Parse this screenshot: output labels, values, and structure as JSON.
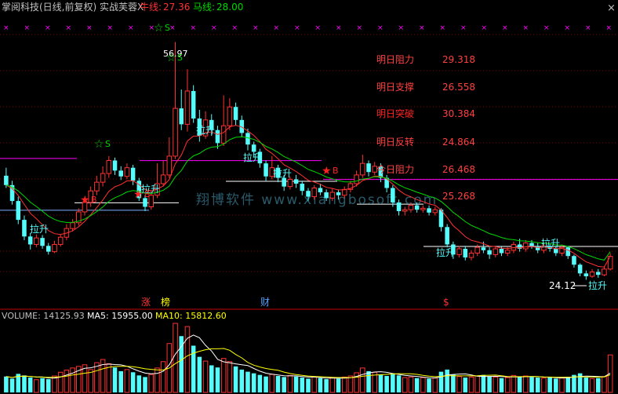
{
  "header": {
    "title": "掌阅科技(日线,前复权) 实战芙蓉X",
    "niu_label": "牛线:",
    "niu_value": "27.36",
    "ma_label": "马线:",
    "ma_value": "28.00",
    "close_icon": "×"
  },
  "colors": {
    "up": "#ff3232",
    "down": "#54fcfc",
    "niu": "#ff3232",
    "ma": "#00d800",
    "magenta": "#ff00ff",
    "level": "#ffffff",
    "grid": "#800000",
    "vol_ma5": "#ffffff",
    "vol_ma10": "#ffff00"
  },
  "panel_labels": {
    "tomorrow_resistance_label": "明日阻力",
    "tomorrow_resistance_value": "29.318",
    "tomorrow_support_label": "明日支撑",
    "tomorrow_support_value": "26.558",
    "tomorrow_breakout_label": "明日突破",
    "tomorrow_breakout_value": "30.384",
    "tomorrow_reversal_label": "明日反转",
    "tomorrow_reversal_value": "24.864",
    "today_resistance_label": "今日阻力",
    "today_resistance_value": "26.468",
    "today_support_value": "25.268"
  },
  "annotations": {
    "high_price": "56.97",
    "low_price": "24.12",
    "pull_up": "拉升",
    "buy": "B",
    "sell": "S",
    "watermark": "翔博软件 www.xiangbosoft.com",
    "event_zhang": "涨",
    "event_bang": "榜",
    "event_cai": "财",
    "event_dollar": "$"
  },
  "volume": {
    "volume_label": "VOLUME: 14125.93",
    "ma5_label": "MA5: 15955.00",
    "ma10_label": "MA10: 15812.60"
  },
  "chart_data": {
    "type": "candlestick",
    "title": "掌阅科技(日线,前复权) 实战芙蓉X",
    "ylim": [
      22,
      58
    ],
    "candles": [
      [
        38.5,
        37.2,
        39.6,
        36.8
      ],
      [
        37.2,
        35.0,
        37.8,
        34.5
      ],
      [
        35.0,
        32.4,
        35.6,
        31.8
      ],
      [
        32.4,
        30.1,
        33.0,
        29.6
      ],
      [
        30.1,
        29.0,
        30.6,
        28.3
      ],
      [
        29.0,
        29.9,
        30.4,
        28.6
      ],
      [
        29.9,
        28.8,
        30.3,
        28.4
      ],
      [
        28.8,
        28.0,
        29.2,
        27.6
      ],
      [
        28.0,
        29.0,
        29.5,
        27.8
      ],
      [
        29.0,
        30.0,
        30.4,
        28.7
      ],
      [
        30.0,
        31.2,
        31.8,
        29.6
      ],
      [
        31.2,
        32.0,
        32.5,
        30.8
      ],
      [
        32.0,
        33.5,
        34.0,
        31.6
      ],
      [
        33.5,
        34.8,
        35.4,
        33.0
      ],
      [
        34.8,
        36.4,
        37.0,
        34.2
      ],
      [
        36.4,
        37.6,
        38.5,
        35.8
      ],
      [
        37.6,
        38.8,
        39.8,
        37.0
      ],
      [
        38.8,
        40.6,
        41.2,
        38.2
      ],
      [
        40.6,
        39.2,
        41.0,
        38.6
      ],
      [
        39.2,
        38.4,
        39.8,
        37.9
      ],
      [
        38.4,
        39.6,
        40.2,
        38.0
      ],
      [
        39.6,
        37.8,
        40.0,
        37.2
      ],
      [
        37.8,
        35.4,
        38.2,
        35.0
      ],
      [
        35.4,
        34.2,
        35.8,
        33.6
      ],
      [
        34.2,
        35.8,
        36.4,
        33.8
      ],
      [
        35.8,
        37.4,
        40.2,
        35.4
      ],
      [
        37.4,
        38.6,
        40.6,
        37.0
      ],
      [
        38.6,
        41.2,
        43.8,
        38.2
      ],
      [
        41.2,
        47.8,
        56.97,
        40.8
      ],
      [
        47.8,
        45.6,
        50.4,
        44.8
      ],
      [
        45.6,
        50.2,
        53.2,
        44.6
      ],
      [
        50.2,
        46.4,
        51.0,
        45.8
      ],
      [
        46.4,
        44.0,
        47.6,
        43.2
      ],
      [
        44.0,
        46.2,
        47.4,
        43.6
      ],
      [
        46.2,
        44.8,
        47.0,
        44.0
      ],
      [
        44.8,
        43.0,
        45.4,
        42.2
      ],
      [
        43.0,
        45.4,
        49.6,
        42.6
      ],
      [
        45.4,
        48.0,
        49.2,
        44.8
      ],
      [
        48.0,
        46.2,
        48.6,
        45.4
      ],
      [
        46.2,
        44.4,
        46.8,
        43.8
      ],
      [
        44.4,
        42.8,
        45.0,
        42.0
      ],
      [
        42.8,
        41.8,
        43.2,
        41.0
      ],
      [
        41.8,
        40.2,
        42.2,
        39.6
      ],
      [
        40.2,
        38.4,
        40.6,
        37.8
      ],
      [
        38.4,
        39.6,
        41.2,
        38.0
      ],
      [
        39.6,
        38.2,
        40.0,
        37.6
      ],
      [
        38.2,
        37.0,
        38.6,
        36.4
      ],
      [
        37.0,
        38.0,
        38.4,
        36.6
      ],
      [
        38.0,
        37.4,
        38.6,
        36.8
      ],
      [
        37.4,
        36.4,
        37.8,
        35.8
      ],
      [
        36.4,
        35.6,
        36.8,
        35.0
      ],
      [
        35.6,
        36.8,
        37.2,
        35.2
      ],
      [
        36.8,
        36.2,
        37.4,
        35.8
      ],
      [
        36.2,
        35.4,
        36.6,
        35.0
      ],
      [
        35.4,
        36.2,
        36.8,
        35.0
      ],
      [
        36.2,
        35.8,
        36.6,
        35.2
      ],
      [
        35.8,
        36.6,
        37.0,
        35.4
      ],
      [
        36.6,
        37.4,
        37.8,
        36.2
      ],
      [
        37.4,
        38.6,
        39.2,
        37.0
      ],
      [
        38.6,
        40.2,
        41.4,
        38.2
      ],
      [
        40.2,
        39.0,
        40.6,
        38.4
      ],
      [
        39.0,
        39.8,
        40.4,
        38.6
      ],
      [
        39.8,
        38.2,
        40.2,
        37.6
      ],
      [
        38.2,
        36.8,
        38.6,
        36.2
      ],
      [
        36.8,
        34.8,
        37.2,
        34.2
      ],
      [
        34.8,
        33.6,
        35.2,
        33.0
      ],
      [
        33.6,
        33.8,
        34.2,
        33.0
      ],
      [
        33.8,
        34.4,
        34.8,
        33.4
      ],
      [
        34.4,
        33.8,
        34.8,
        33.4
      ],
      [
        33.8,
        34.0,
        34.4,
        33.4
      ],
      [
        34.0,
        33.4,
        34.4,
        33.0
      ],
      [
        33.4,
        33.8,
        34.2,
        33.0
      ],
      [
        33.8,
        31.4,
        34.0,
        30.8
      ],
      [
        31.4,
        29.0,
        31.8,
        28.6
      ],
      [
        29.0,
        27.6,
        29.4,
        27.0
      ],
      [
        27.6,
        28.4,
        28.8,
        27.2
      ],
      [
        28.4,
        27.2,
        28.8,
        26.8
      ],
      [
        27.2,
        27.8,
        28.2,
        26.8
      ],
      [
        27.8,
        28.6,
        29.0,
        27.4
      ],
      [
        28.6,
        28.2,
        29.4,
        27.8
      ],
      [
        28.2,
        27.6,
        28.6,
        27.0
      ],
      [
        27.6,
        28.4,
        28.8,
        27.2
      ],
      [
        28.4,
        27.8,
        28.8,
        27.4
      ],
      [
        27.8,
        28.2,
        28.6,
        27.4
      ],
      [
        28.2,
        29.0,
        29.4,
        27.8
      ],
      [
        29.0,
        28.4,
        29.8,
        28.0
      ],
      [
        28.4,
        29.2,
        29.6,
        28.0
      ],
      [
        29.2,
        28.8,
        29.6,
        28.4
      ],
      [
        28.8,
        28.2,
        29.2,
        27.8
      ],
      [
        28.2,
        28.8,
        29.2,
        27.8
      ],
      [
        28.8,
        28.4,
        29.2,
        28.0
      ],
      [
        28.4,
        27.8,
        28.8,
        27.4
      ],
      [
        27.8,
        28.6,
        29.0,
        27.4
      ],
      [
        28.6,
        27.4,
        28.8,
        27.0
      ],
      [
        27.4,
        26.2,
        27.6,
        25.8
      ],
      [
        26.2,
        25.0,
        26.4,
        24.6
      ],
      [
        25.0,
        24.6,
        25.4,
        24.12
      ],
      [
        24.6,
        25.2,
        25.6,
        24.4
      ],
      [
        25.2,
        24.8,
        25.6,
        24.4
      ],
      [
        24.8,
        25.6,
        26.0,
        24.6
      ],
      [
        25.6,
        27.36,
        27.8,
        25.4
      ]
    ],
    "levels": {
      "tomorrow_resistance": 29.318,
      "tomorrow_support": 26.558,
      "tomorrow_breakout": 30.384,
      "tomorrow_reversal": 24.864,
      "today_resistance": 26.468,
      "today_support": 25.268
    },
    "niu_last": 27.36,
    "ma_last": 28.0,
    "volume_last": 14125.93,
    "volume_ma5": 15955.0,
    "volume_ma10": 15812.6,
    "volumes": [
      6000,
      5200,
      7000,
      6400,
      5600,
      4800,
      5400,
      5000,
      6200,
      7600,
      8400,
      9200,
      9800,
      10400,
      8600,
      11200,
      12400,
      10800,
      9400,
      8000,
      8600,
      7600,
      6400,
      5800,
      6800,
      9200,
      11600,
      18400,
      26000,
      21200,
      24800,
      17600,
      13400,
      11800,
      10200,
      9400,
      12800,
      11600,
      9800,
      8600,
      7800,
      7200,
      6600,
      6000,
      6800,
      6200,
      5800,
      6400,
      6000,
      5600,
      5200,
      5800,
      5400,
      5000,
      5600,
      5200,
      5800,
      6200,
      7400,
      9200,
      8000,
      7600,
      6800,
      6200,
      7000,
      6400,
      5600,
      5800,
      5400,
      5600,
      5200,
      5400,
      7800,
      8600,
      6800,
      6000,
      5600,
      5800,
      6200,
      6600,
      6000,
      5800,
      5400,
      5600,
      6400,
      6000,
      6200,
      5800,
      5600,
      5400,
      5800,
      5200,
      5400,
      5800,
      6600,
      7200,
      5600,
      5200,
      5400,
      6000,
      14125.93
    ]
  }
}
